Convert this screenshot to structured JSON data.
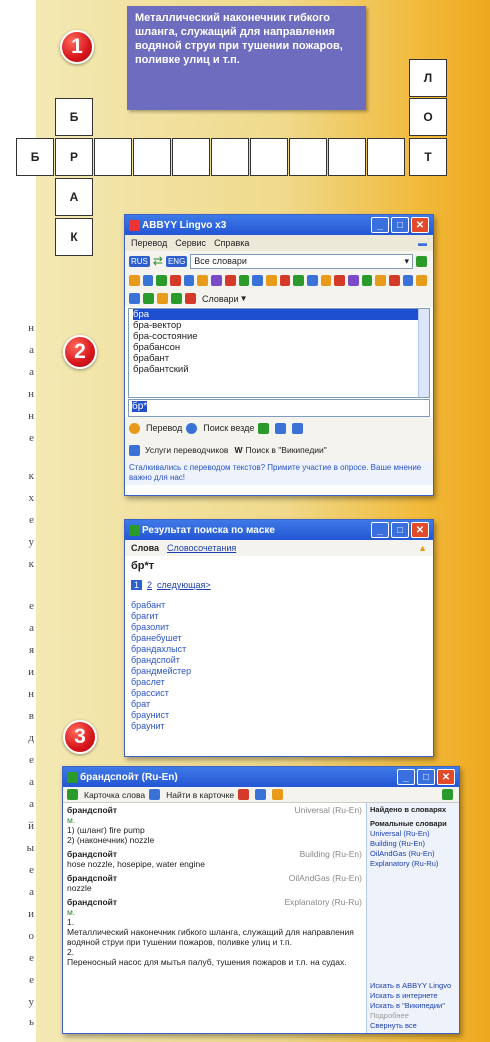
{
  "left_margin_chars": [
    "н",
    "а",
    "а",
    "н",
    "н",
    "е",
    "к",
    "х",
    "е",
    "у",
    "к",
    "е",
    "а",
    "я",
    "и",
    "н",
    "в",
    "д",
    "е",
    "а",
    "а",
    "й",
    "ы",
    "е",
    "а",
    "и",
    "о",
    "е",
    "е",
    "у",
    "ь",
    "т",
    "а",
    "и",
    "я",
    "е",
    "и",
    "ь"
  ],
  "section_numbers": [
    "1",
    "2",
    "3"
  ],
  "crossword": {
    "clue": "Металлический наконечник гибкого шланга, служащий для направления водяной струи при тушении пожаров, поливке улиц и т.п.",
    "cells": {
      "b1": "Б",
      "r0": "Б",
      "r1": "Р",
      "a1": "А",
      "k1": "К",
      "l8": "Л",
      "o8": "О",
      "t8": "Т"
    }
  },
  "lingvo": {
    "title": "ABBYY Lingvo x3",
    "menu": [
      "Перевод",
      "Сервис",
      "Справка"
    ],
    "lang1": "RUS",
    "lang2": "ENG",
    "dict_select": "Все словари",
    "dict_menu": "Словари",
    "list": [
      "бра",
      "бра-вектор",
      "бра-состояние",
      "брабансон",
      "брабант",
      "брабантский"
    ],
    "input_value": "бр*",
    "btn_translate": "Перевод",
    "btn_search": "Поиск везде",
    "btn_services": "Услуги переводчиков",
    "btn_wiki": "Поиск в \"Википедии\"",
    "status_text": "Сталкивались с переводом текстов? Примите участие в опросе. Ваше мнение важно для нас!"
  },
  "mask": {
    "title": "Результат поиска по маске",
    "tab_words": "Слова",
    "tab_phrases": "Словосочетания",
    "query": "бр*т",
    "page_cur": "1",
    "page_next": "2",
    "next_link": "следующая>",
    "results": [
      "брабант",
      "брагит",
      "бразолит",
      "бранебушет",
      "брандахлыст",
      "брандспойт",
      "брандмейстер",
      "браслет",
      "брассист",
      "брат",
      "браунист",
      "браунит",
      "брахибласт"
    ]
  },
  "brand": {
    "title": "брандспойт (Ru-En)",
    "tb_back": "Карточка слова",
    "tb_find": "Найти в карточке",
    "entries": [
      {
        "word": "брандспойт",
        "dict": "Universal (Ru-En)",
        "marker": "м.",
        "lines": [
          "1) (шланг) fire pump",
          "2) (наконечник) nozzle"
        ]
      },
      {
        "word": "брандспойт",
        "dict": "Building (Ru-En)",
        "marker": "",
        "lines": [
          "hose nozzle, hosepipe, water engine"
        ]
      },
      {
        "word": "брандспойт",
        "dict": "OilAndGas (Ru-En)",
        "marker": "",
        "lines": [
          "nozzle"
        ]
      },
      {
        "word": "брандспойт",
        "dict": "Explanatory (Ru-Ru)",
        "marker": "м.",
        "lines": [
          "1.",
          "Металлический наконечник гибкого шланга, служащий для направления водяной струи при тушении пожаров, поливке улиц и т.п.",
          "2.",
          "Переносный насос для мытья палуб, тушения пожаров и т.п. на судах."
        ]
      }
    ],
    "side_title": "Найдено в словарях",
    "side_section": "Ромальные словари",
    "side_dicts": [
      "Universal (Ru-En)",
      "Building (Ru-En)",
      "OilAndGas (Ru-En)",
      "Explanatory (Ru-Ru)"
    ],
    "side_links": [
      "Искать в ABBYY Lingvo",
      "Искать в интернете",
      "Искать в \"Википедии\"",
      "Подробнее",
      "Свернуть все"
    ]
  }
}
